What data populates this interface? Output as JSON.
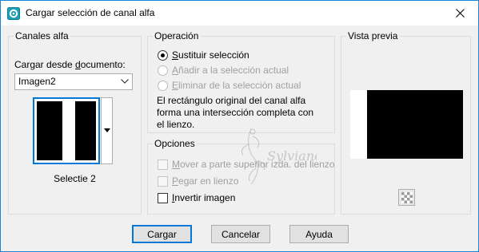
{
  "window": {
    "title": "Cargar selección de canal alfa"
  },
  "canales": {
    "group_label": "Canales alfa",
    "load_from_label_pre": "Cargar desde ",
    "load_from_label_u": "d",
    "load_from_label_post": "ocumento:",
    "document_value": "Imagen2",
    "selection_name": "Selectie 2"
  },
  "operacion": {
    "group_label": "Operación",
    "options": [
      {
        "u": "S",
        "rest": "ustituir selección",
        "checked": true,
        "disabled": false
      },
      {
        "u": "A",
        "rest": "ñadir a la selección actual",
        "checked": false,
        "disabled": true
      },
      {
        "u": "E",
        "rest": "liminar de la selección actual",
        "checked": false,
        "disabled": true
      }
    ],
    "description": "El rectángulo original del canal alfa forma una intersección completa con el lienzo."
  },
  "opciones": {
    "group_label": "Opciones",
    "move_pre": "",
    "move_u": "M",
    "move_rest": "over a parte superior izda. del lienzo",
    "paste_u": "P",
    "paste_rest": "egar en lienzo",
    "invert_u": "I",
    "invert_rest": "nvertir imagen"
  },
  "preview": {
    "group_label": "Vista previa"
  },
  "buttons": {
    "load": "Cargar",
    "cancel": "Cancelar",
    "help": "Ayuda"
  },
  "watermark_text": "Sylviane",
  "colors": {
    "accent": "#0078d7",
    "window_border": "#1883d7",
    "background": "#f0f0f0"
  },
  "icons": {
    "app": "psp-app-icon",
    "close": "close-icon",
    "dropdown": "chevron-down-icon",
    "checker": "checkerboard-icon"
  }
}
